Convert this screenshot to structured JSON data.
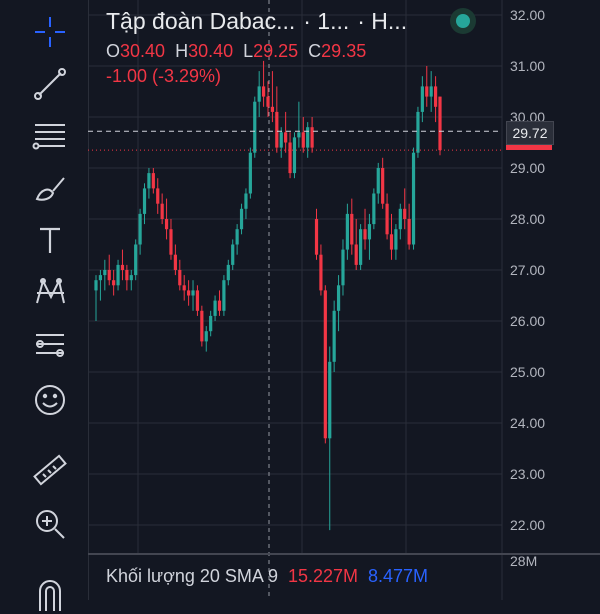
{
  "header": {
    "symbol": "Tập đoàn Dabac...",
    "interval": "· 1...",
    "exchange": "· H...",
    "ohlc": [
      {
        "label": "O",
        "value": "30.40"
      },
      {
        "label": "H",
        "value": "30.40"
      },
      {
        "label": "L",
        "value": "29.25"
      },
      {
        "label": "C",
        "value": "29.35"
      }
    ],
    "change": "-1.00 (-3.29%)"
  },
  "price_axis": {
    "ticks": [
      "32.00",
      "31.00",
      "30.00",
      "29.00",
      "28.00",
      "27.00",
      "26.00",
      "25.00",
      "24.00",
      "23.00",
      "22.00"
    ],
    "current_price": "29.72",
    "volume_scale_label": "28M"
  },
  "volume": {
    "label": "Khối lượng 20 SMA 9",
    "value": "15.227M",
    "sma_value": "8.477M"
  },
  "colors": {
    "up": "#26a69a",
    "down": "#f23645",
    "background": "#131722",
    "grid": "#2a2e39",
    "volume_sma": "#2962ff"
  },
  "toolbar": {
    "icons": [
      "crosshair-icon",
      "trend-line-icon",
      "fib-retracement-icon",
      "brush-icon",
      "text-icon",
      "pattern-icon",
      "prediction-icon",
      "emoji-icon",
      "ruler-icon",
      "zoom-in-icon",
      "magnet-icon"
    ]
  },
  "chart_data": {
    "type": "candlestick",
    "ylim": [
      21.6,
      32.2
    ],
    "last_price": 29.72,
    "close_price": 29.35,
    "candles": [
      {
        "o": 26.6,
        "h": 26.9,
        "l": 26.0,
        "c": 26.8
      },
      {
        "o": 26.8,
        "h": 27.0,
        "l": 26.4,
        "c": 26.9
      },
      {
        "o": 26.9,
        "h": 27.2,
        "l": 26.6,
        "c": 27.0
      },
      {
        "o": 27.0,
        "h": 27.3,
        "l": 26.7,
        "c": 26.8
      },
      {
        "o": 26.8,
        "h": 27.0,
        "l": 26.5,
        "c": 26.7
      },
      {
        "o": 26.7,
        "h": 27.2,
        "l": 26.6,
        "c": 27.1
      },
      {
        "o": 27.1,
        "h": 27.4,
        "l": 26.8,
        "c": 27.0
      },
      {
        "o": 27.0,
        "h": 27.1,
        "l": 26.6,
        "c": 26.8
      },
      {
        "o": 26.8,
        "h": 27.0,
        "l": 26.6,
        "c": 26.9
      },
      {
        "o": 26.9,
        "h": 27.6,
        "l": 26.8,
        "c": 27.5
      },
      {
        "o": 27.5,
        "h": 28.2,
        "l": 27.3,
        "c": 28.1
      },
      {
        "o": 28.1,
        "h": 28.7,
        "l": 27.9,
        "c": 28.6
      },
      {
        "o": 28.6,
        "h": 29.0,
        "l": 28.4,
        "c": 28.9
      },
      {
        "o": 28.9,
        "h": 29.0,
        "l": 28.5,
        "c": 28.6
      },
      {
        "o": 28.6,
        "h": 28.8,
        "l": 28.1,
        "c": 28.3
      },
      {
        "o": 28.3,
        "h": 28.5,
        "l": 27.9,
        "c": 28.0
      },
      {
        "o": 28.0,
        "h": 28.4,
        "l": 27.6,
        "c": 27.8
      },
      {
        "o": 27.8,
        "h": 28.0,
        "l": 27.2,
        "c": 27.3
      },
      {
        "o": 27.3,
        "h": 27.5,
        "l": 26.9,
        "c": 27.0
      },
      {
        "o": 27.0,
        "h": 27.2,
        "l": 26.6,
        "c": 26.7
      },
      {
        "o": 26.7,
        "h": 26.9,
        "l": 26.4,
        "c": 26.6
      },
      {
        "o": 26.6,
        "h": 26.8,
        "l": 26.3,
        "c": 26.5
      },
      {
        "o": 26.5,
        "h": 26.8,
        "l": 26.2,
        "c": 26.6
      },
      {
        "o": 26.6,
        "h": 26.7,
        "l": 26.1,
        "c": 26.2
      },
      {
        "o": 26.2,
        "h": 26.3,
        "l": 25.5,
        "c": 25.6
      },
      {
        "o": 25.6,
        "h": 25.9,
        "l": 25.4,
        "c": 25.8
      },
      {
        "o": 25.8,
        "h": 26.2,
        "l": 25.7,
        "c": 26.1
      },
      {
        "o": 26.1,
        "h": 26.5,
        "l": 26.0,
        "c": 26.4
      },
      {
        "o": 26.4,
        "h": 26.6,
        "l": 26.1,
        "c": 26.2
      },
      {
        "o": 26.2,
        "h": 26.9,
        "l": 26.1,
        "c": 26.8
      },
      {
        "o": 26.8,
        "h": 27.2,
        "l": 26.7,
        "c": 27.1
      },
      {
        "o": 27.1,
        "h": 27.6,
        "l": 27.0,
        "c": 27.5
      },
      {
        "o": 27.5,
        "h": 27.9,
        "l": 27.3,
        "c": 27.8
      },
      {
        "o": 27.8,
        "h": 28.3,
        "l": 27.7,
        "c": 28.2
      },
      {
        "o": 28.2,
        "h": 28.6,
        "l": 28.0,
        "c": 28.5
      },
      {
        "o": 28.5,
        "h": 29.4,
        "l": 28.4,
        "c": 29.3
      },
      {
        "o": 29.3,
        "h": 30.4,
        "l": 29.2,
        "c": 30.3
      },
      {
        "o": 30.3,
        "h": 30.9,
        "l": 30.0,
        "c": 30.6
      },
      {
        "o": 30.6,
        "h": 31.1,
        "l": 30.2,
        "c": 30.4
      },
      {
        "o": 30.4,
        "h": 30.7,
        "l": 30.0,
        "c": 30.2
      },
      {
        "o": 30.2,
        "h": 30.9,
        "l": 29.9,
        "c": 30.1
      },
      {
        "o": 30.1,
        "h": 30.6,
        "l": 29.3,
        "c": 29.4
      },
      {
        "o": 29.4,
        "h": 29.8,
        "l": 29.2,
        "c": 29.7
      },
      {
        "o": 29.7,
        "h": 30.1,
        "l": 29.3,
        "c": 29.5
      },
      {
        "o": 29.5,
        "h": 29.7,
        "l": 28.8,
        "c": 28.9
      },
      {
        "o": 28.9,
        "h": 29.7,
        "l": 28.8,
        "c": 29.6
      },
      {
        "o": 29.6,
        "h": 30.3,
        "l": 29.4,
        "c": 29.7
      },
      {
        "o": 29.7,
        "h": 30.0,
        "l": 29.3,
        "c": 29.4
      },
      {
        "o": 29.4,
        "h": 29.9,
        "l": 29.2,
        "c": 29.8
      },
      {
        "o": 29.8,
        "h": 30.0,
        "l": 29.3,
        "c": 29.4
      },
      {
        "o": 28.0,
        "h": 28.2,
        "l": 27.2,
        "c": 27.3
      },
      {
        "o": 27.3,
        "h": 27.5,
        "l": 26.5,
        "c": 26.6
      },
      {
        "o": 26.6,
        "h": 26.7,
        "l": 23.6,
        "c": 23.7
      },
      {
        "o": 23.7,
        "h": 25.5,
        "l": 21.9,
        "c": 25.2
      },
      {
        "o": 25.2,
        "h": 26.4,
        "l": 25.0,
        "c": 26.2
      },
      {
        "o": 26.2,
        "h": 26.9,
        "l": 25.8,
        "c": 26.7
      },
      {
        "o": 26.7,
        "h": 27.6,
        "l": 26.5,
        "c": 27.4
      },
      {
        "o": 27.4,
        "h": 28.3,
        "l": 27.2,
        "c": 28.1
      },
      {
        "o": 28.1,
        "h": 28.4,
        "l": 27.3,
        "c": 27.5
      },
      {
        "o": 27.5,
        "h": 28.0,
        "l": 27.0,
        "c": 27.1
      },
      {
        "o": 27.1,
        "h": 27.9,
        "l": 27.0,
        "c": 27.8
      },
      {
        "o": 27.8,
        "h": 28.2,
        "l": 27.4,
        "c": 27.6
      },
      {
        "o": 27.6,
        "h": 28.1,
        "l": 27.2,
        "c": 27.9
      },
      {
        "o": 27.9,
        "h": 28.6,
        "l": 27.8,
        "c": 28.5
      },
      {
        "o": 28.5,
        "h": 29.1,
        "l": 28.3,
        "c": 29.0
      },
      {
        "o": 29.0,
        "h": 29.2,
        "l": 28.2,
        "c": 28.3
      },
      {
        "o": 28.3,
        "h": 28.5,
        "l": 27.6,
        "c": 27.7
      },
      {
        "o": 27.7,
        "h": 28.1,
        "l": 27.2,
        "c": 27.4
      },
      {
        "o": 27.4,
        "h": 27.9,
        "l": 27.2,
        "c": 27.8
      },
      {
        "o": 27.8,
        "h": 28.3,
        "l": 27.6,
        "c": 28.2
      },
      {
        "o": 28.2,
        "h": 28.6,
        "l": 27.8,
        "c": 28.0
      },
      {
        "o": 28.0,
        "h": 28.3,
        "l": 27.4,
        "c": 27.5
      },
      {
        "o": 27.5,
        "h": 29.4,
        "l": 27.4,
        "c": 29.3
      },
      {
        "o": 29.3,
        "h": 30.2,
        "l": 29.2,
        "c": 30.1
      },
      {
        "o": 30.1,
        "h": 30.8,
        "l": 29.9,
        "c": 30.6
      },
      {
        "o": 30.6,
        "h": 31.0,
        "l": 30.2,
        "c": 30.4
      },
      {
        "o": 30.4,
        "h": 30.9,
        "l": 30.1,
        "c": 30.6
      },
      {
        "o": 30.6,
        "h": 30.8,
        "l": 29.9,
        "c": 30.2
      },
      {
        "o": 30.4,
        "h": 30.4,
        "l": 29.25,
        "c": 29.35
      }
    ]
  }
}
